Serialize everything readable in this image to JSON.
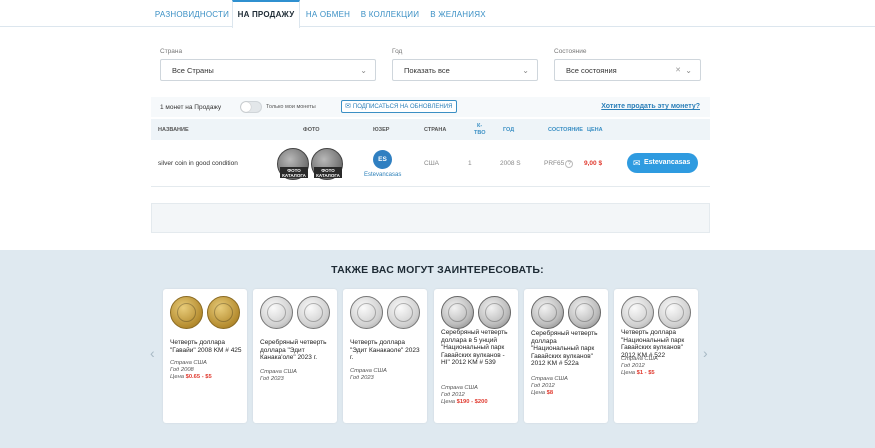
{
  "tabs": [
    "РАЗНОВИДНОСТИ",
    "НА ПРОДАЖУ",
    "НА ОБМЕН",
    "В КОЛЛЕКЦИИ",
    "В ЖЕЛАНИЯХ"
  ],
  "filters": {
    "country_label": "Страна",
    "country_value": "Все Страны",
    "year_label": "Год",
    "year_value": "Показать все",
    "condition_label": "Состояние",
    "condition_value": "Все состояния"
  },
  "listing": {
    "count_text": "1 монет на Продажу",
    "toggle_label": "Только мои монеты",
    "subscribe_label": "ПОДПИСАТЬСЯ НА ОБНОВЛЕНИЯ",
    "sell_link": "Хотите продать эту монету?"
  },
  "columns": {
    "name": "НАЗВАНИЕ",
    "photo": "ФОТО",
    "user": "ЮЗЕР",
    "country": "СТРАНА",
    "qty_line1": "К-",
    "qty_line2": "ТВО",
    "year": "ГОД",
    "condition": "СОСТОЯНИЕ",
    "price": "ЦЕНА"
  },
  "row": {
    "name": "silver coin in good condition",
    "photo_tag_line1": "ФОТО",
    "photo_tag_line2": "КАТАЛОГА",
    "avatar": "ES",
    "user": "Estevancasas",
    "country": "США",
    "qty": "1",
    "year": "2008 S",
    "condition": "PRF65",
    "condition_help": "?",
    "price": "9,00 $",
    "buy_label": "Estevancasas"
  },
  "recommend": {
    "title": "ТАКЖЕ ВАС МОГУТ ЗАИНТЕРЕСОВАТЬ:",
    "prev": "‹",
    "next": "›",
    "cards": [
      {
        "title": "Четверть доллара \"Гавайи\" 2008 KM # 425",
        "country": "Страна США",
        "year": "Год 2008",
        "price_label": "Цена ",
        "price": "$0.65 - $5",
        "style": "gold"
      },
      {
        "title": "Серебряный четверть доллара \"Эдит Канака'оле\" 2023 г.",
        "country": "Страна США",
        "year": "Год 2023",
        "price_label": "",
        "price": "",
        "style": "silver"
      },
      {
        "title": "Четверть доллара \"Эдит Канакаоле\" 2023 г.",
        "country": "Страна США",
        "year": "Год 2023",
        "price_label": "",
        "price": "",
        "style": "silver"
      },
      {
        "title": "Серебряный четверть доллара в 5 унций \"Национальный парк Гавайских вулканов - HI\" 2012 KM # 539",
        "country": "Страна США",
        "year": "Год 2012",
        "price_label": "Цена ",
        "price": "$190 - $200",
        "style": "silver-dark"
      },
      {
        "title": "Серебряный четверть доллара \"Национальный парк Гавайских вулканов\" 2012 KM # 522a",
        "country": "Страна США",
        "year": "Год 2012",
        "price_label": "Цена ",
        "price": "$8",
        "style": "silver-dark"
      },
      {
        "title": "Четверть доллара \"Национальный парк Гавайских вулканов\" 2012 KM # 522",
        "country": "Страна США",
        "year": "Год 2012",
        "price_label": "Цена ",
        "price": "$1 - $5",
        "style": "silver"
      }
    ]
  }
}
